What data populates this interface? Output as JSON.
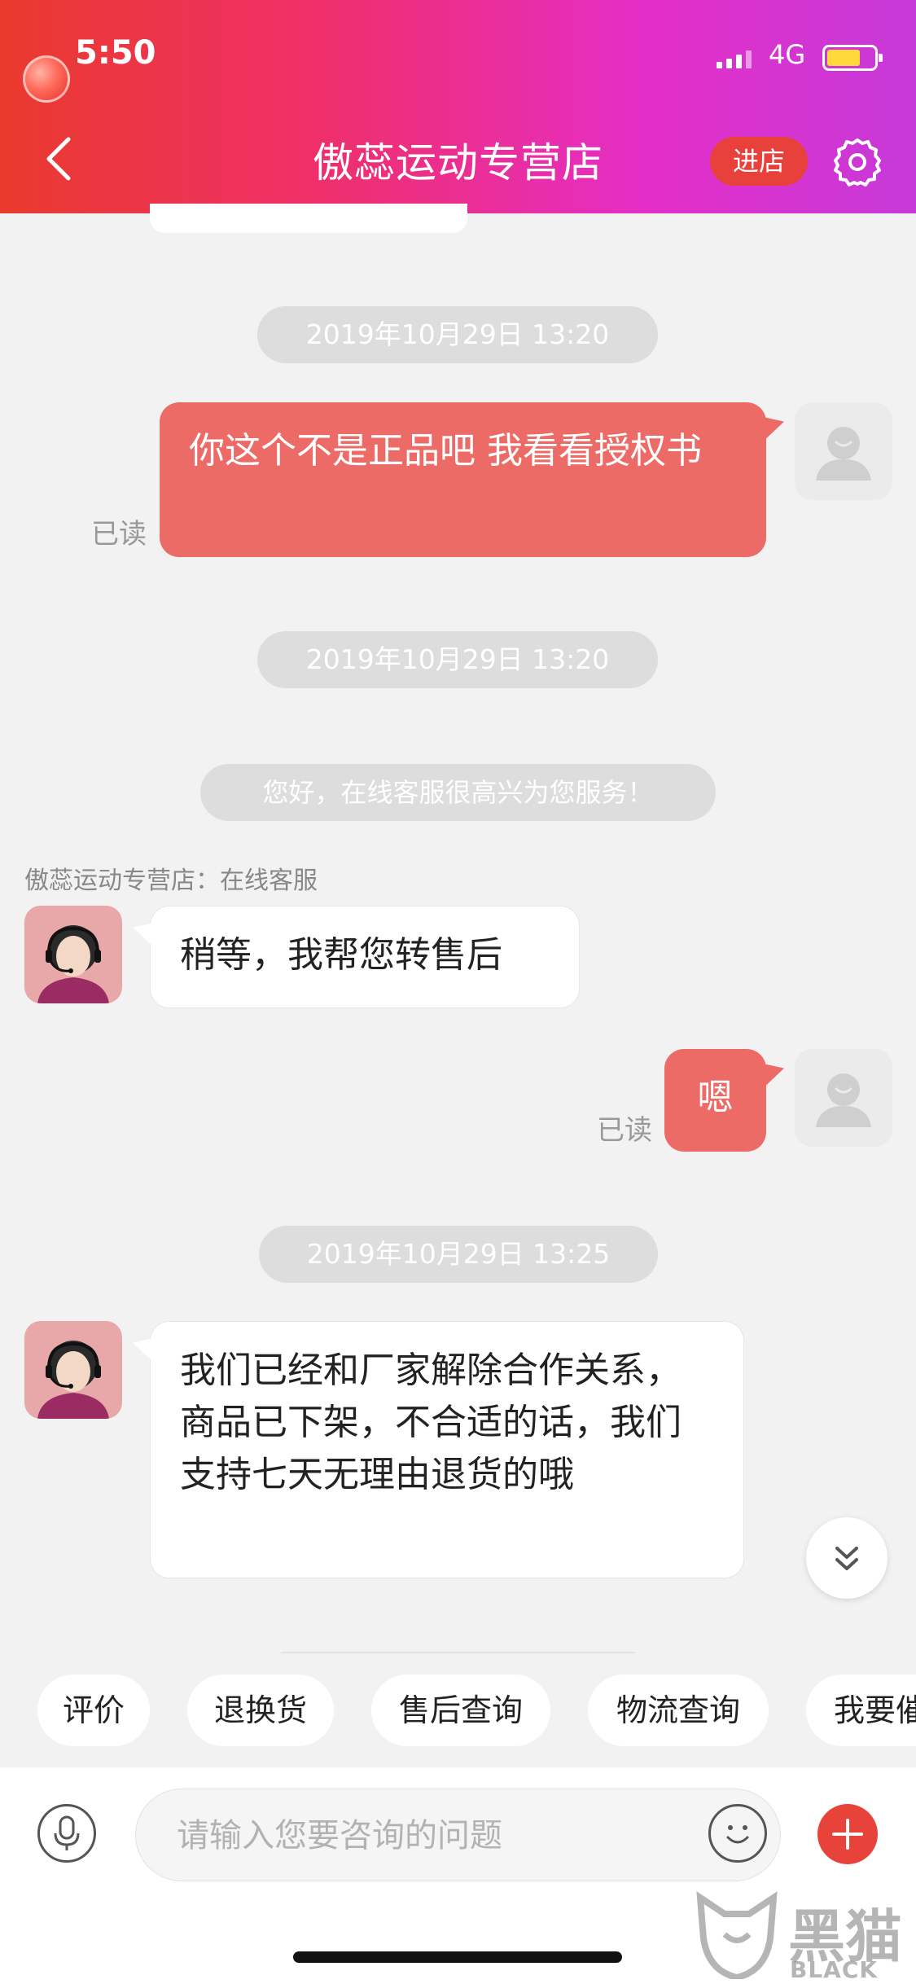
{
  "status_bar": {
    "time": "5:50",
    "network": "4G"
  },
  "header": {
    "title": "傲蕊运动专营店",
    "enter_store_label": "进店"
  },
  "messages": {
    "timestamps": [
      "2019年10月29日 13:20",
      "2019年10月29日 13:20",
      "2019年10月29日 13:25"
    ],
    "user_msg_1": {
      "text": "你这个不是正品吧 我看看授权书",
      "status": "已读"
    },
    "system_greeting": "您好，在线客服很高兴为您服务！",
    "sender_label": "傲蕊运动专营店：在线客服",
    "agent_msg_1": "稍等，我帮您转售后",
    "user_msg_2": {
      "text": "嗯",
      "status": "已读"
    },
    "agent_msg_2": "我们已经和厂家解除合作关系，商品已下架，不合适的话，我们支持七天无理由退货的哦"
  },
  "quick_replies": [
    "评价",
    "退换货",
    "售后查询",
    "物流查询",
    "我要催"
  ],
  "input": {
    "placeholder": "请输入您要咨询的问题"
  },
  "watermark": {
    "cn": "黑猫",
    "en": "BLACK CAT"
  },
  "colors": {
    "header_gradient_start": "#ea3a2d",
    "header_gradient_end": "#c63ad9",
    "user_bubble": "#ec6b66",
    "accent_red": "#e8433a"
  }
}
